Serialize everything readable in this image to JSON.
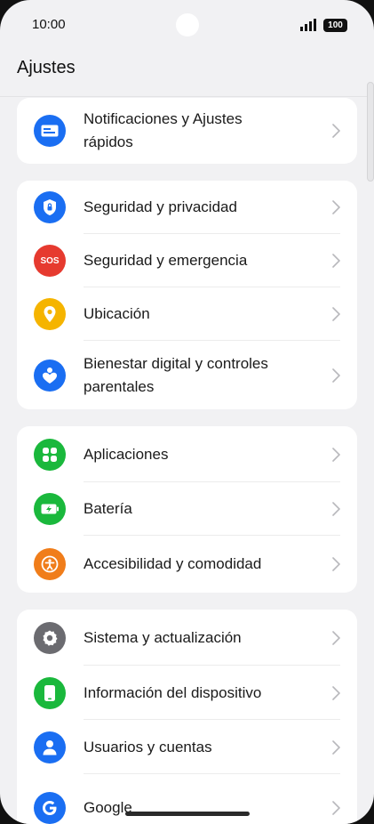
{
  "status_bar": {
    "time": "10:00",
    "battery": "100"
  },
  "header": {
    "title": "Ajustes"
  },
  "colors": {
    "blue": "#1a6ef2",
    "red": "#e63a2f",
    "yellow": "#f5b400",
    "green": "#1ab83c",
    "orange": "#f07d1a",
    "gray": "#6b6b70"
  },
  "groups": [
    {
      "items": [
        {
          "label_line1": "Notificaciones y Ajustes",
          "label_line2": "rápidos",
          "icon": "notification-panel-icon",
          "color": "blue"
        }
      ]
    },
    {
      "items": [
        {
          "label_line1": "Seguridad y privacidad",
          "label_line2": "",
          "icon": "shield-lock-icon",
          "color": "blue"
        },
        {
          "label_line1": "Seguridad y emergencia",
          "label_line2": "",
          "icon": "sos-icon",
          "color": "red",
          "icon_text": "SOS"
        },
        {
          "label_line1": "Ubicación",
          "label_line2": "",
          "icon": "location-pin-icon",
          "color": "yellow"
        },
        {
          "label_line1": "Bienestar digital y controles",
          "label_line2": "parentales",
          "icon": "wellbeing-heart-icon",
          "color": "blue"
        }
      ]
    },
    {
      "items": [
        {
          "label_line1": "Aplicaciones",
          "label_line2": "",
          "icon": "apps-grid-icon",
          "color": "green"
        },
        {
          "label_line1": "Batería",
          "label_line2": "",
          "icon": "battery-icon",
          "color": "green"
        },
        {
          "label_line1": "Accesibilidad y comodidad",
          "label_line2": "",
          "icon": "accessibility-icon",
          "color": "orange"
        }
      ]
    },
    {
      "items": [
        {
          "label_line1": "Sistema y actualización",
          "label_line2": "",
          "icon": "gear-icon",
          "color": "gray"
        },
        {
          "label_line1": "Información del dispositivo",
          "label_line2": "",
          "icon": "phone-device-icon",
          "color": "green"
        },
        {
          "label_line1": "Usuarios y cuentas",
          "label_line2": "",
          "icon": "user-icon",
          "color": "blue"
        },
        {
          "label_line1": "Google",
          "label_line2": "",
          "icon": "google-icon",
          "color": "blue"
        }
      ]
    }
  ]
}
